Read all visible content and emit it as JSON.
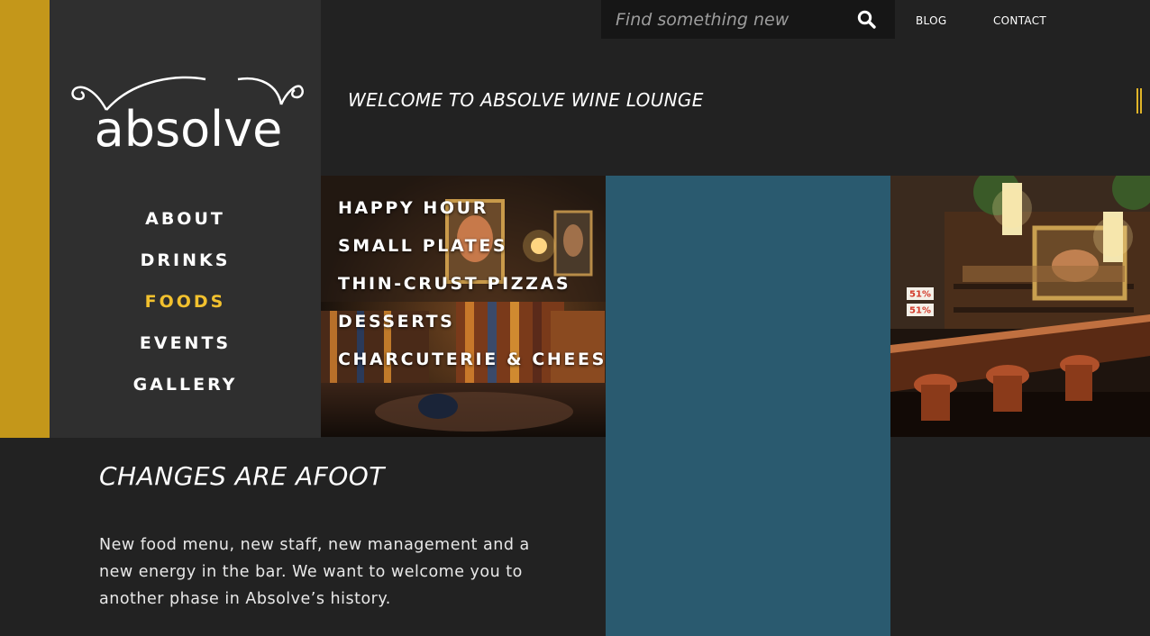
{
  "brand": {
    "logo_text": "absolve",
    "accent_color": "#c4971a",
    "active_color": "#f2c12e",
    "blue_tile_color": "#2a5a6f"
  },
  "search": {
    "placeholder": "Find something new",
    "icon": "search-icon"
  },
  "top_links": {
    "blog": "BLOG",
    "contact": "CONTACT"
  },
  "welcome": "WELCOME TO ABSOLVE WINE LOUNGE",
  "nav": {
    "items": [
      {
        "label": "ABOUT",
        "active": false
      },
      {
        "label": "DRINKS",
        "active": false
      },
      {
        "label": "FOODS",
        "active": true
      },
      {
        "label": "EVENTS",
        "active": false
      },
      {
        "label": "GALLERY",
        "active": false
      }
    ]
  },
  "foods_menu": {
    "items": [
      {
        "label": "HAPPY HOUR"
      },
      {
        "label": "SMALL PLATES"
      },
      {
        "label": "THIN-CRUST PIZZAS"
      },
      {
        "label": "DESSERTS"
      },
      {
        "label": "CHARCUTERIE & CHEESE"
      }
    ]
  },
  "bar_photo": {
    "sign_1": "51%",
    "sign_2": "51%"
  },
  "article": {
    "title": "CHANGES ARE AFOOT",
    "body": "New food menu, new staff, new management and a new energy in the bar. We want to welcome you to another phase in Absolve’s history."
  }
}
